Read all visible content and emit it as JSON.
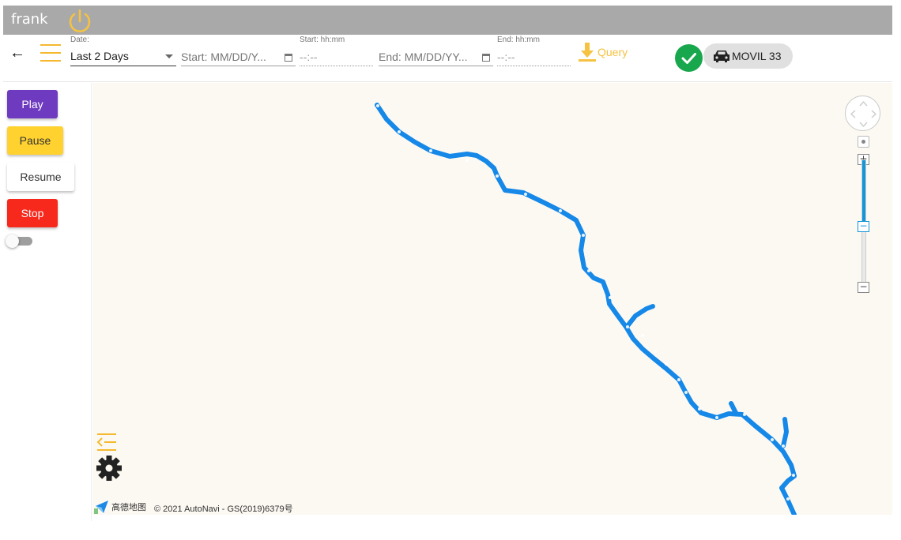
{
  "header": {
    "username": "frank",
    "power_icon": "power-icon"
  },
  "toolbar": {
    "back_icon": "arrow-left-icon",
    "menu_icon": "hamburger-menu-icon",
    "date_label": "Date:",
    "date_value": "Last 2 Days",
    "start_date_placeholder": "Start: MM/DD/Y...",
    "start_time_label": "Start: hh:mm",
    "start_time_placeholder": "--:--",
    "end_date_placeholder": "End: MM/DD/YY...",
    "end_time_label": "End: hh:mm",
    "end_time_placeholder": "--:--",
    "query_label": "Query",
    "status_icon": "check-icon",
    "vehicle_name": "MOVIL 33",
    "vehicle_icon": "car-icon"
  },
  "sidebar": {
    "play": "Play",
    "pause": "Pause",
    "resume": "Resume",
    "stop": "Stop",
    "toggle_on": false
  },
  "map": {
    "logo_text": "高德地图",
    "copyright": "© 2021 AutoNavi - GS(2019)6379号",
    "route_color": "#1588e8",
    "zoom_fraction": 0.53
  },
  "colors": {
    "accent": "#f5c242",
    "play": "#6e3bc0",
    "pause": "#ffd230",
    "stop": "#f7281c",
    "status_ok": "#19a74d"
  }
}
